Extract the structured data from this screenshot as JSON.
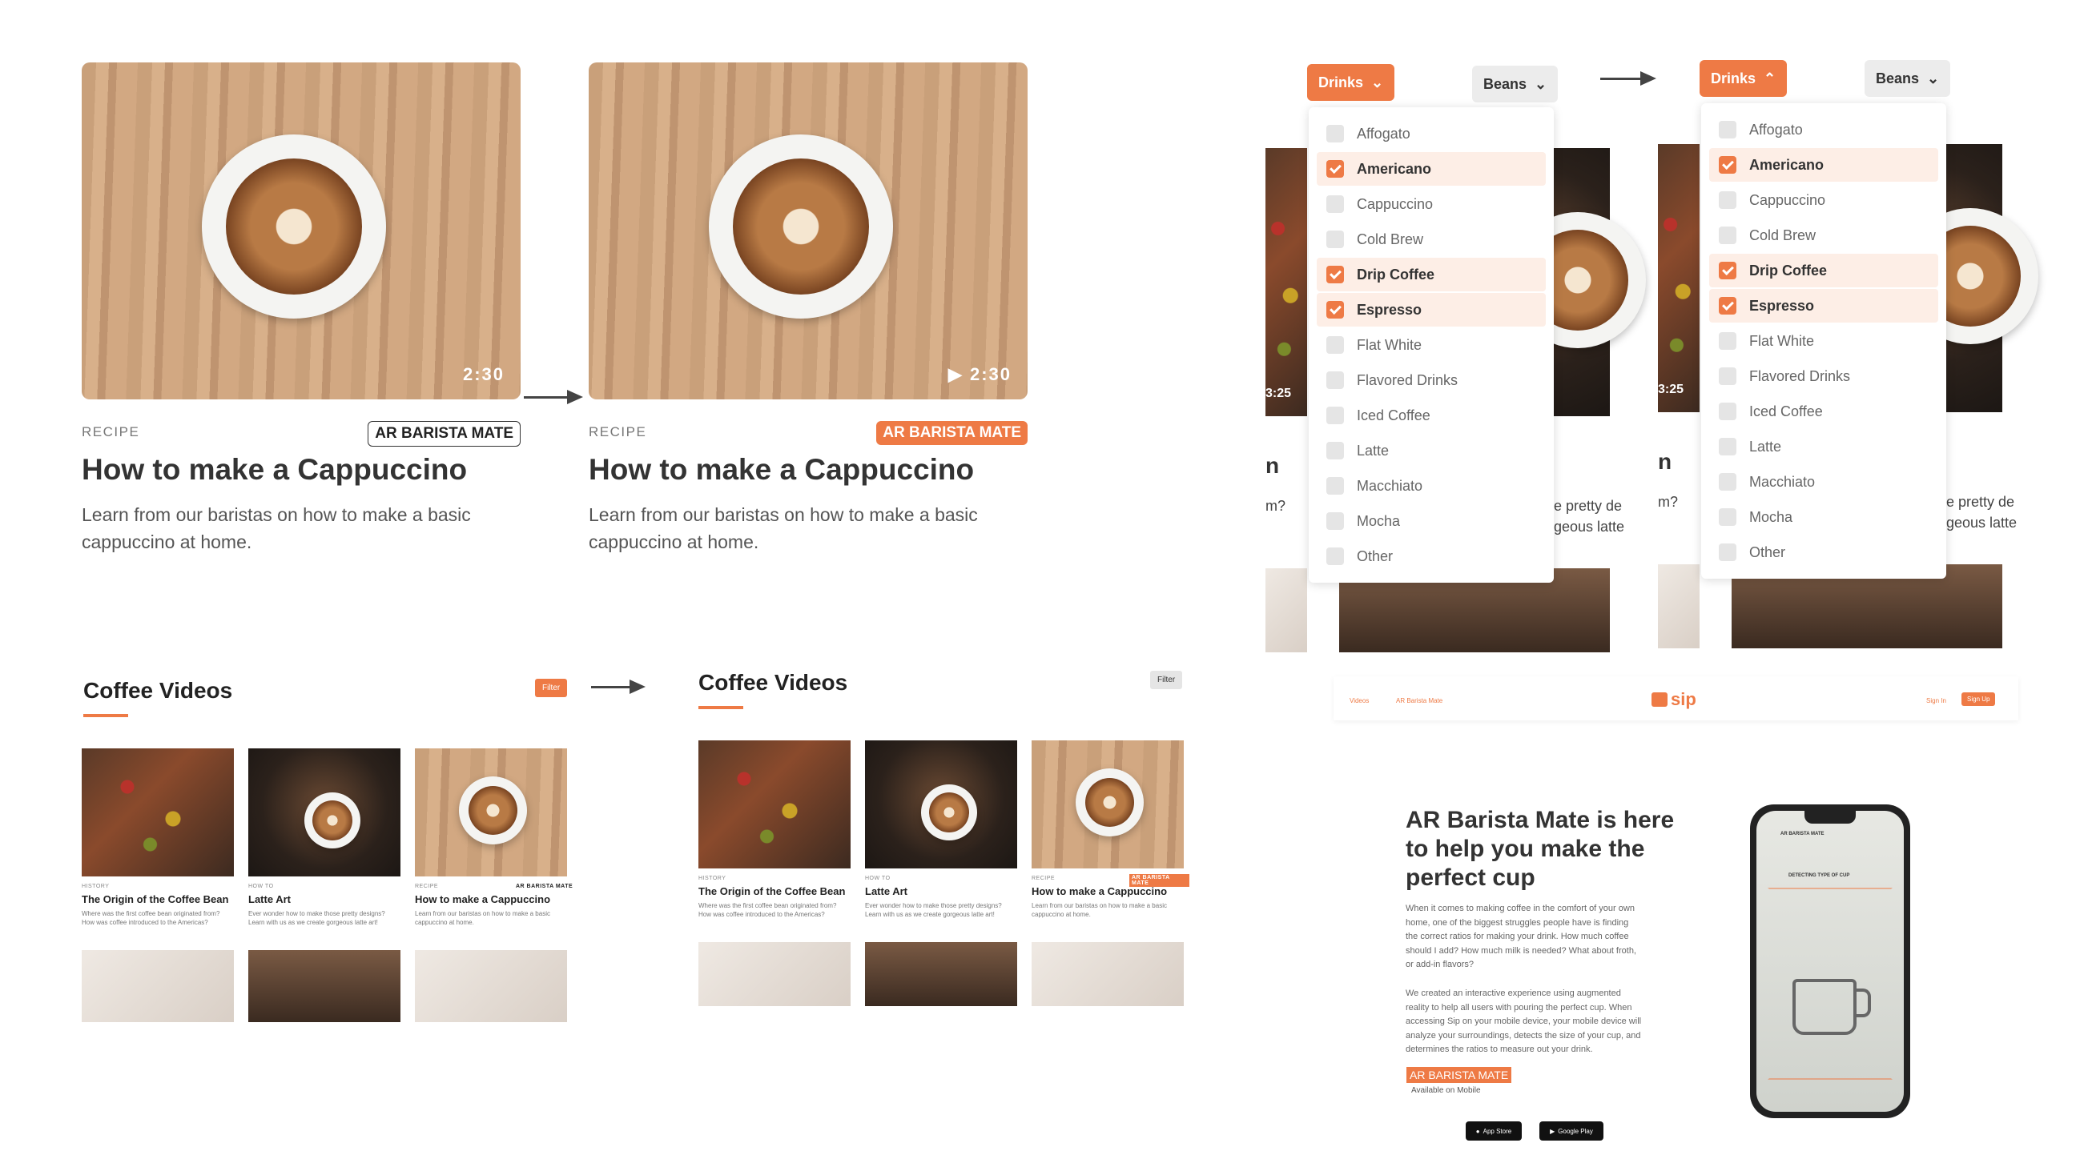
{
  "card1": {
    "duration": "2:30",
    "category": "RECIPE",
    "badge": "AR BARISTA MATE",
    "title": "How to make a Cappuccino",
    "desc_line1": "Learn from our baristas on how to make a basic",
    "desc_line2": "cappuccino at home."
  },
  "card2": {
    "duration": "2:30",
    "category": "RECIPE",
    "badge": "AR BARISTA MATE",
    "title": "How to make a Cappuccino",
    "desc_line1": "Learn from our baristas on how to make a basic",
    "desc_line2": "cappuccino at home."
  },
  "videos_a": {
    "title": "Coffee Videos",
    "filter": "Filter",
    "items": [
      {
        "meta": "HISTORY",
        "title": "The Origin of the Coffee Bean",
        "desc1": "Where was the first coffee bean originated from?",
        "desc2": "How was coffee introduced to the Americas?",
        "badge": ""
      },
      {
        "meta": "HOW TO",
        "title": "Latte Art",
        "desc1": "Ever wonder how to make those pretty designs?",
        "desc2": "Learn with us as we create gorgeous latte art!",
        "badge": ""
      },
      {
        "meta": "RECIPE",
        "title": "How to make a Cappuccino",
        "desc1": "Learn from our baristas on how to make a basic",
        "desc2": "cappuccino at home.",
        "badge": "AR BARISTA MATE"
      }
    ]
  },
  "videos_b": {
    "title": "Coffee Videos",
    "filter": "Filter",
    "items": [
      {
        "meta": "HISTORY",
        "title": "The Origin of the Coffee Bean",
        "desc1": "Where was the first coffee bean originated from?",
        "desc2": "How was coffee introduced to the Americas?",
        "badge": ""
      },
      {
        "meta": "HOW TO",
        "title": "Latte Art",
        "desc1": "Ever wonder how to make those pretty designs?",
        "desc2": "Learn with us as we create gorgeous latte art!",
        "badge": ""
      },
      {
        "meta": "RECIPE",
        "title": "How to make a Cappuccino",
        "desc1": "Learn from our baristas on how to make a basic",
        "desc2": "cappuccino at home.",
        "badge": "AR BARISTA MATE"
      }
    ]
  },
  "dropdown_a": {
    "drinks": "Drinks",
    "beans": "Beans",
    "items": [
      "Affogato",
      "Americano",
      "Cappuccino",
      "Cold Brew",
      "Drip Coffee",
      "Espresso",
      "Flat White",
      "Flavored Drinks",
      "Iced Coffee",
      "Latte",
      "Macchiato",
      "Mocha",
      "Other"
    ],
    "checked": [
      false,
      true,
      false,
      false,
      true,
      true,
      false,
      false,
      false,
      false,
      false,
      false,
      false
    ],
    "bg_duration": "3:25",
    "bg_n": "n",
    "bg_m": "m?",
    "bg_r1": "e pretty de",
    "bg_r2": "geous latte"
  },
  "dropdown_b": {
    "drinks": "Drinks",
    "beans": "Beans",
    "items": [
      "Affogato",
      "Americano",
      "Cappuccino",
      "Cold Brew",
      "Drip Coffee",
      "Espresso",
      "Flat White",
      "Flavored Drinks",
      "Iced Coffee",
      "Latte",
      "Macchiato",
      "Mocha",
      "Other"
    ],
    "checked": [
      false,
      true,
      false,
      false,
      true,
      true,
      false,
      false,
      false,
      false,
      false,
      false,
      false
    ],
    "bg_duration": "3:25",
    "bg_n": "n",
    "bg_m": "m?",
    "bg_r1": "e pretty de",
    "bg_r2": "geous latte"
  },
  "landing": {
    "nav_videos": "Videos",
    "nav_ar": "AR Barista Mate",
    "logo": "sip",
    "sign_in": "Sign In",
    "sign_up": "Sign Up",
    "headline1": "AR Barista Mate is here",
    "headline2": "to help you make the",
    "headline3": "perfect cup",
    "p1": [
      "When it comes to making coffee in the comfort of your own",
      "home, one of the biggest struggles people have is finding",
      "the correct ratios for making your drink.  How much coffee",
      "should I add?  How much milk is needed?  What about froth,",
      "or add-in flavors?"
    ],
    "p2": [
      "We created an interactive experience using augmented",
      "reality to help all users with pouring the perfect cup.  When",
      "accessing Sip on your mobile device, your mobile device will",
      "analyze your surroundings, detects the size of your cup, and",
      "determines the ratios to measure out your drink."
    ],
    "badge": "AR BARISTA MATE",
    "available": "Available on Mobile",
    "app_store": "App Store",
    "google_play": "Google Play",
    "phone_label": "AR BARISTA MATE",
    "phone_detect": "DETECTING TYPE OF CUP"
  },
  "colors": {
    "accent": "#ee7a45"
  }
}
